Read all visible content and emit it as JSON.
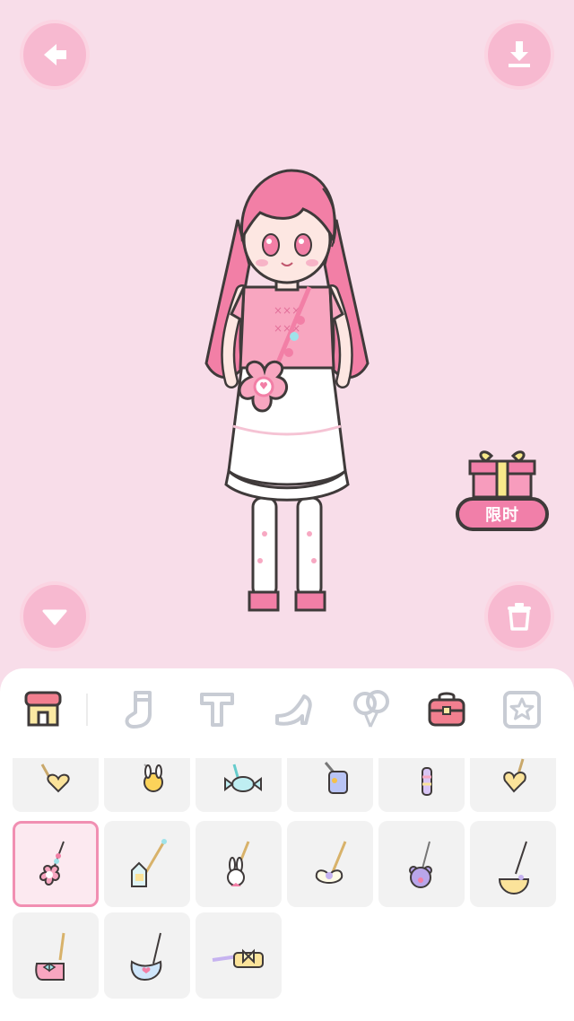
{
  "toolbar": {
    "back_icon": "arrow-left-icon",
    "download_icon": "download-icon",
    "collapse_icon": "triangle-down-icon",
    "delete_icon": "trash-icon"
  },
  "promo": {
    "label": "限时",
    "icon": "gift-box-icon"
  },
  "category_tabs": [
    {
      "name": "shop",
      "icon": "shop-icon",
      "active": true
    },
    {
      "name": "socks",
      "icon": "sock-icon"
    },
    {
      "name": "text",
      "icon": "letter-t-icon"
    },
    {
      "name": "shoes",
      "icon": "high-heel-icon"
    },
    {
      "name": "balloons",
      "icon": "balloon-icon"
    },
    {
      "name": "bags",
      "icon": "bag-icon"
    },
    {
      "name": "favorites",
      "icon": "star-icon"
    }
  ],
  "items": [
    {
      "icon": "heart-pendant-bag-icon"
    },
    {
      "icon": "bunny-chick-bag-icon"
    },
    {
      "icon": "candy-bag-icon"
    },
    {
      "icon": "purple-phone-bag-icon"
    },
    {
      "icon": "striped-tube-bag-icon"
    },
    {
      "icon": "yellow-heart-bag-icon"
    },
    {
      "icon": "pink-flower-bag-icon",
      "selected": true
    },
    {
      "icon": "milk-carton-bag-icon"
    },
    {
      "icon": "bunny-bag-icon"
    },
    {
      "icon": "wings-bag-icon"
    },
    {
      "icon": "bear-bag-icon"
    },
    {
      "icon": "lemon-slice-bag-icon"
    },
    {
      "icon": "pink-boot-bag-icon"
    },
    {
      "icon": "blue-slip-bag-icon"
    },
    {
      "icon": "bow-pouch-icon"
    }
  ],
  "colors": {
    "background": "#f8dde9",
    "accent": "#f7b9d0",
    "selected_border": "#f18fb2"
  }
}
